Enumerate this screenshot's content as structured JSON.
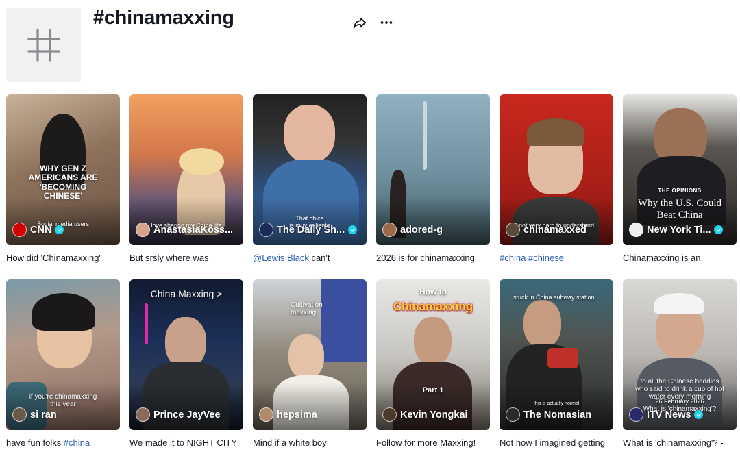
{
  "page": {
    "title": "#chinamaxxing",
    "share_icon": "share-arrow-icon",
    "more_icon": "ellipsis-icon",
    "avatar_icon": "hashtag-icon"
  },
  "videos": [
    {
      "author": "CNN",
      "verified": true,
      "overlay": "WHY GEN Z\nAMERICANS ARE\n'BECOMING\nCHINESE'",
      "overlay_small": "Social media users",
      "caption": "How did 'Chinamaxxing'",
      "caption_tag": "",
      "bg": "#9a7f68",
      "avatar_color": "#cc0000"
    },
    {
      "author": "AnastasiaKoss...",
      "verified": false,
      "overlay": "",
      "overlay_small": "love sharing my China life",
      "caption": "But srsly where was",
      "caption_tag": "",
      "bg": "#c47a4e",
      "avatar_color": "#d8a38c"
    },
    {
      "author": "The Daily Sh...",
      "verified": true,
      "overlay": "",
      "overlay_small": "That chica\nis muy caliente",
      "caption": "",
      "caption_tag": "@Lewis Black",
      "caption_tail": " can't",
      "bg": "#2f4f74",
      "avatar_color": "#1b2b5a"
    },
    {
      "author": "adored-g",
      "verified": false,
      "overlay": "",
      "overlay_small": "",
      "caption": "2026 is for chinamaxxing",
      "caption_tag": "",
      "bg": "#7e9ba6",
      "avatar_color": "#9a6a4a"
    },
    {
      "author": "chinamaxxed",
      "verified": false,
      "overlay": "",
      "overlay_small": "not very hard to understand",
      "caption": "",
      "caption_tag": "#china #chinese",
      "bg": "#b8231d",
      "avatar_color": "#5a4a3a"
    },
    {
      "author": "New York Ti...",
      "verified": true,
      "overlay_label": "THE OPINIONS",
      "overlay": "Why the U.S. Could\nBeat China",
      "overlay_small": "",
      "caption": "Chinamaxxing is an",
      "caption_tag": "",
      "bg": "#3a3835",
      "avatar_color": "#eeeeee"
    },
    {
      "author": "si ran",
      "verified": false,
      "overlay": "",
      "overlay_small": "if you're chinamaxxing\nthis year",
      "caption": "have fun folks ",
      "caption_tag": "#china",
      "bg": "#a58a7b",
      "avatar_color": "#6a5a4a"
    },
    {
      "author": "Prince JayVee",
      "verified": false,
      "overlay": "China Maxxing >",
      "overlay_small": "",
      "caption": "We made it to NIGHT CITY",
      "caption_tag": "",
      "bg": "#1c2438",
      "avatar_color": "#8a6a5a"
    },
    {
      "author": "hepsima",
      "verified": false,
      "overlay": "",
      "overlay_small": "Cultivation\nmaxxing",
      "caption": "Mind if a white boy",
      "caption_tag": "",
      "bg": "#8c8478",
      "avatar_color": "#b08a6a"
    },
    {
      "author": "Kevin Yongkai",
      "verified": false,
      "overlay_label": "How to",
      "overlay": "Chinamaxxing",
      "overlay_small": "Part 1",
      "caption": "Follow for more Maxxing!",
      "caption_tag": "",
      "bg": "#bcbab6",
      "avatar_color": "#4a3a2a"
    },
    {
      "author": "The Nomasian",
      "verified": false,
      "overlay": "",
      "overlay_small": "stuck in China subway station",
      "overlay_bottom": "this is actually normal",
      "caption": "Not how I imagined getting",
      "caption_tag": "",
      "bg": "#4a4e4a",
      "avatar_color": "#2a2a2a"
    },
    {
      "author": "ITV News",
      "verified": true,
      "overlay": "",
      "overlay_small": "to all the Chinese baddies\nwho said to drink a cup of hot\nwater every morning",
      "overlay_bottom": "What is 'chinamaxxing'?",
      "date_label": "26 February 2026",
      "caption": "What is 'chinamaxxing'? -",
      "caption_tag": "",
      "bg": "#c9c7c4",
      "avatar_color": "#2a2a6a"
    }
  ]
}
